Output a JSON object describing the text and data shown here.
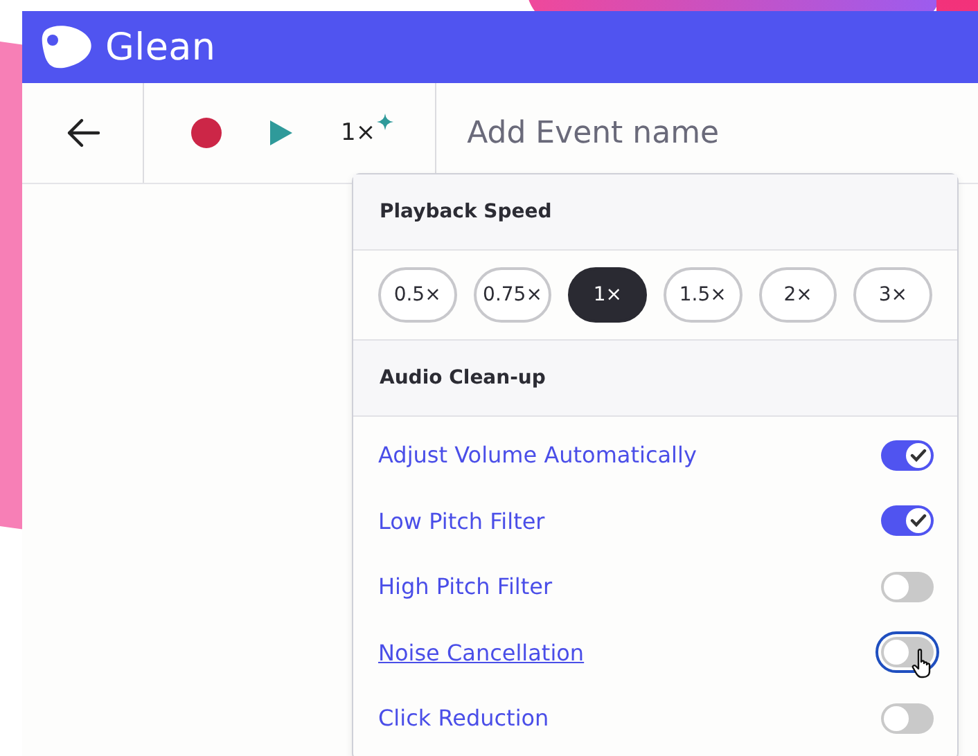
{
  "app": {
    "name": "Glean"
  },
  "toolbar": {
    "speed": "1×",
    "event_name": {
      "placeholder": "Add Event name"
    }
  },
  "playback_speed": {
    "title": "Playback Speed",
    "options": [
      {
        "label": "0.5×",
        "selected": false
      },
      {
        "label": "0.75×",
        "selected": false
      },
      {
        "label": "1×",
        "selected": true
      },
      {
        "label": "1.5×",
        "selected": false
      },
      {
        "label": "2×",
        "selected": false
      },
      {
        "label": "3×",
        "selected": false
      }
    ]
  },
  "audio_cleanup": {
    "title": "Audio Clean-up",
    "options": [
      {
        "label": "Adjust Volume Automatically",
        "on": true,
        "focused": false
      },
      {
        "label": "Low Pitch Filter",
        "on": true,
        "focused": false
      },
      {
        "label": "High Pitch Filter",
        "on": false,
        "focused": false
      },
      {
        "label": "Noise Cancellation",
        "on": false,
        "focused": true
      },
      {
        "label": "Click Reduction",
        "on": false,
        "focused": false
      }
    ]
  }
}
